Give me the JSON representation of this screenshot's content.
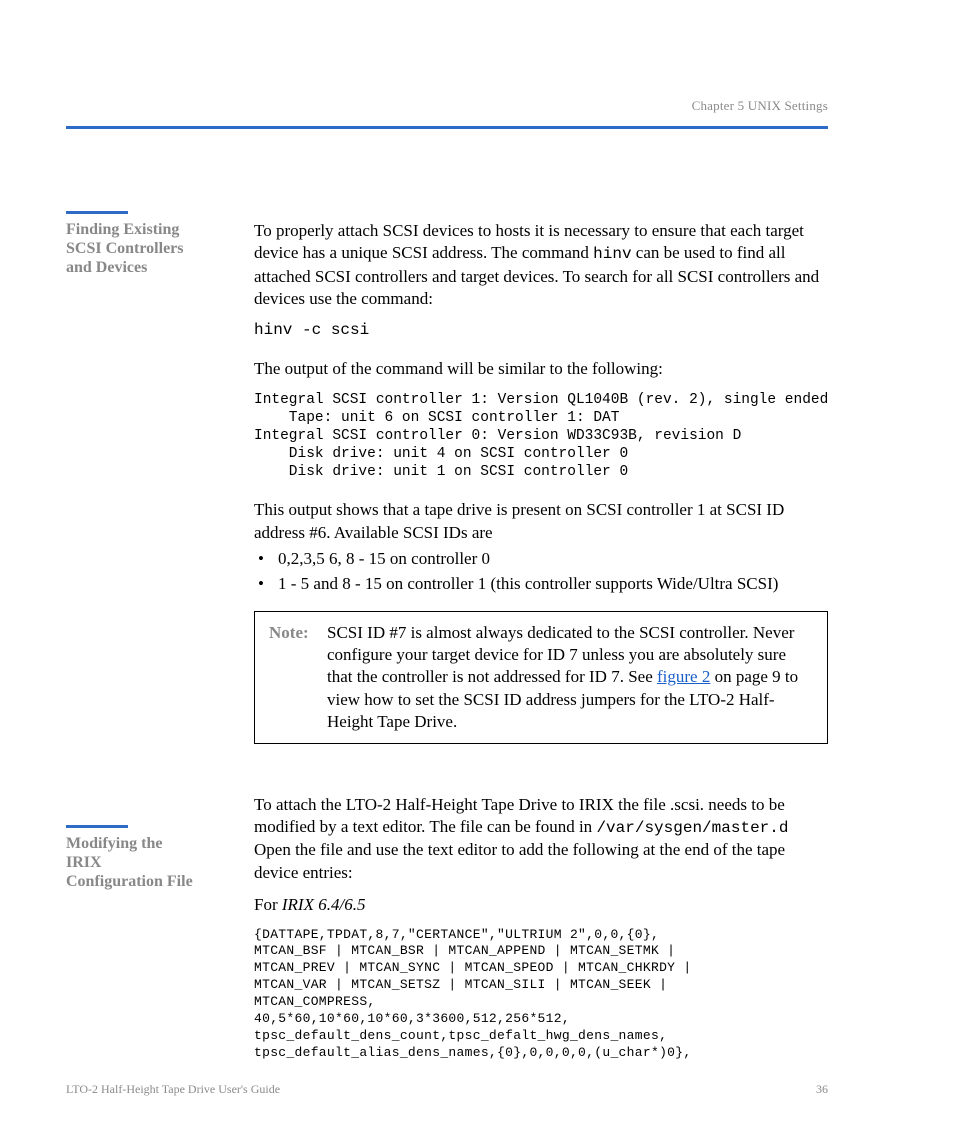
{
  "running_head": "Chapter 5  UNIX Settings",
  "sections": {
    "a": {
      "title_lines": [
        "Finding Existing",
        "SCSI Controllers",
        "and Devices"
      ],
      "p1_pre": "To properly attach SCSI devices to hosts it is necessary to ensure that each target device has a unique SCSI address. The command ",
      "p1_cmd": "hinv",
      "p1_post": " can be used to find all attached SCSI controllers and target devices. To search for all SCSI controllers and devices use the command:",
      "cmd1": "hinv -c scsi",
      "p2": "The output of the command will be similar to the following:",
      "out": "Integral SCSI controller 1: Version QL1040B (rev. 2), single ended\n    Tape: unit 6 on SCSI controller 1: DAT\nIntegral SCSI controller 0: Version WD33C93B, revision D\n    Disk drive: unit 4 on SCSI controller 0\n    Disk drive: unit 1 on SCSI controller 0",
      "p3": "This output shows that a tape drive is present on SCSI controller 1 at SCSI ID address #6. Available SCSI IDs are",
      "bullets": [
        "0,2,3,5 6, 8 - 15 on controller 0",
        "1 - 5 and 8 - 15 on controller 1 (this controller supports Wide/Ultra SCSI)"
      ],
      "note_label": "Note:",
      "note_pre": "SCSI ID #7 is almost always dedicated to the SCSI controller. Never configure your target device for ID 7 unless you are absolutely sure that the controller is not addressed for ID 7. See ",
      "note_link": "figure 2",
      "note_post": " on page 9  to view how to set the SCSI ID address jumpers for the LTO-2 Half-Height Tape Drive."
    },
    "b": {
      "title_lines": [
        "Modifying the",
        "IRIX",
        "Configuration File"
      ],
      "p1_a": "To attach the LTO-2 Half-Height Tape Drive to IRIX the file .scsi. needs to be modified by a text editor. The file can be found in ",
      "p1_path": "/var/sysgen/master.d",
      "p1_b": "Open the file and use the text editor to add the following at the end of the tape device entries:",
      "p2_pre": "For ",
      "p2_em": "IRIX 6.4/6.5",
      "cmd2": "{DATTAPE,TPDAT,8,7,\"CERTANCE\",\"ULTRIUM 2\",0,0,{0},\nMTCAN_BSF | MTCAN_BSR | MTCAN_APPEND | MTCAN_SETMK |\nMTCAN_PREV | MTCAN_SYNC | MTCAN_SPEOD | MTCAN_CHKRDY |\nMTCAN_VAR | MTCAN_SETSZ | MTCAN_SILI | MTCAN_SEEK |\nMTCAN_COMPRESS,\n40,5*60,10*60,10*60,3*3600,512,256*512,\ntpsc_default_dens_count,tpsc_defalt_hwg_dens_names,\ntpsc_default_alias_dens_names,{0},0,0,0,0,(u_char*)0},"
    }
  },
  "footer": {
    "title": "LTO-2 Half-Height Tape Drive User's Guide",
    "page": "36"
  }
}
